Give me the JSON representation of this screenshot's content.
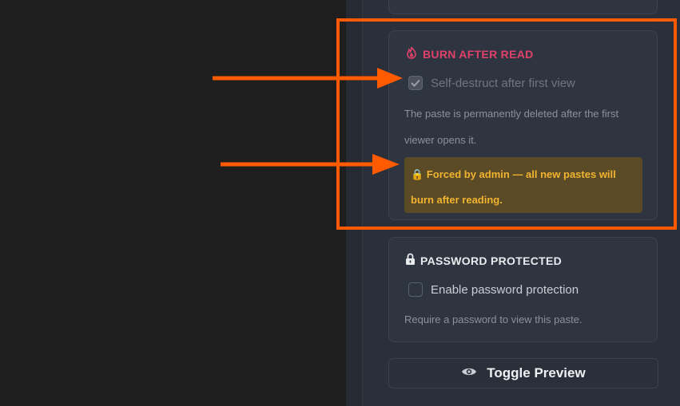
{
  "burn_after_read": {
    "title": "BURN AFTER READ",
    "checkbox_label": "Self-destruct after first view",
    "checked": true,
    "description": "The paste is permanently deleted after the first viewer opens it.",
    "admin_notice": "Forced by admin — all new pastes will burn after reading."
  },
  "password_protected": {
    "title": "PASSWORD PROTECTED",
    "checkbox_label": "Enable password protection",
    "checked": false,
    "description": "Require a password to view this paste."
  },
  "toggle_preview": {
    "label": "Toggle Preview"
  },
  "colors": {
    "accent_burn": "#e0416b",
    "warning_text": "#f2b431",
    "annotation": "#ff5a00"
  },
  "icons": {
    "burn": "fire-icon",
    "password": "lock-icon",
    "preview": "eye-icon",
    "notice": "lock-icon"
  }
}
